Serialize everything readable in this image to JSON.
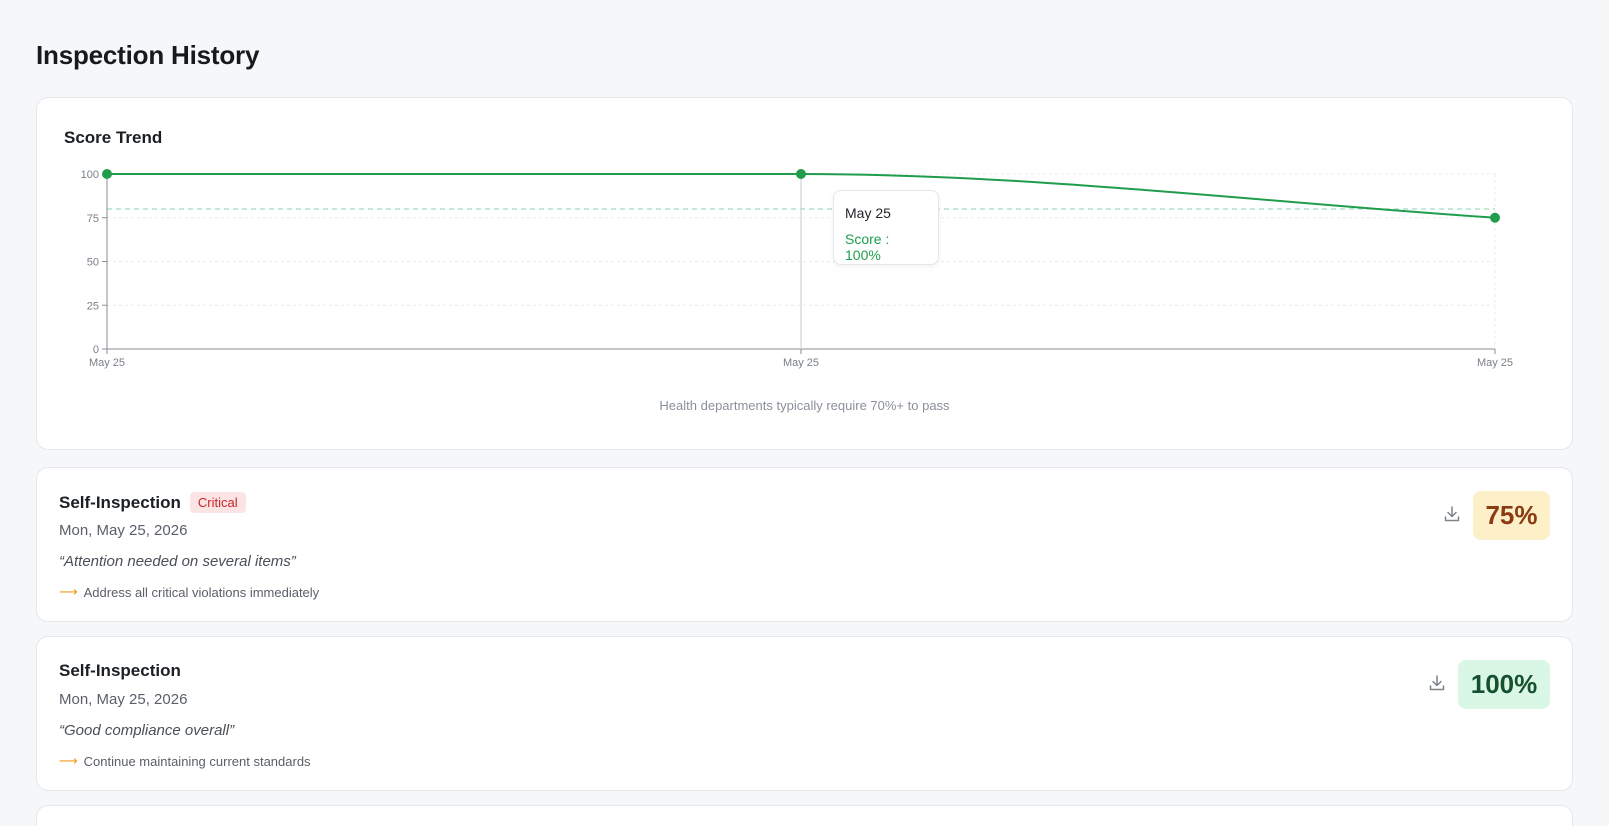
{
  "page": {
    "title": "Inspection History"
  },
  "chart": {
    "title": "Score Trend",
    "note": "Health departments typically require 70%+ to pass",
    "tooltip": {
      "date": "May 25",
      "score": "Score : 100%"
    }
  },
  "chart_data": {
    "type": "line",
    "title": "Score Trend",
    "x": [
      "May 25",
      "May 25",
      "May 25"
    ],
    "series": [
      {
        "values": [
          100,
          100,
          75
        ],
        "color": "#1f9d4c"
      }
    ],
    "ylim": [
      0,
      100
    ],
    "yticks": [
      0,
      25,
      50,
      75,
      100
    ],
    "reference_line": {
      "value": 80,
      "style": "dashed",
      "color": "#9fdcc0"
    },
    "grid": true
  },
  "inspections": [
    {
      "type": "Self-Inspection",
      "badge": "Critical",
      "date": "Mon, May 25, 2026",
      "quote": "“Attention needed on several items”",
      "action": "Address all critical violations immediately",
      "score": "75%"
    },
    {
      "type": "Self-Inspection",
      "date": "Mon, May 25, 2026",
      "quote": "“Good compliance overall”",
      "action": "Continue maintaining current standards",
      "score": "100%"
    }
  ],
  "icons": {
    "download": "download-icon",
    "arrow": "arrow-right-icon"
  },
  "colors": {
    "accent": "#1f9d4c",
    "critical": "#c4262b",
    "warn_bg": "#fdefc8",
    "good_bg": "#d9f7e4"
  }
}
